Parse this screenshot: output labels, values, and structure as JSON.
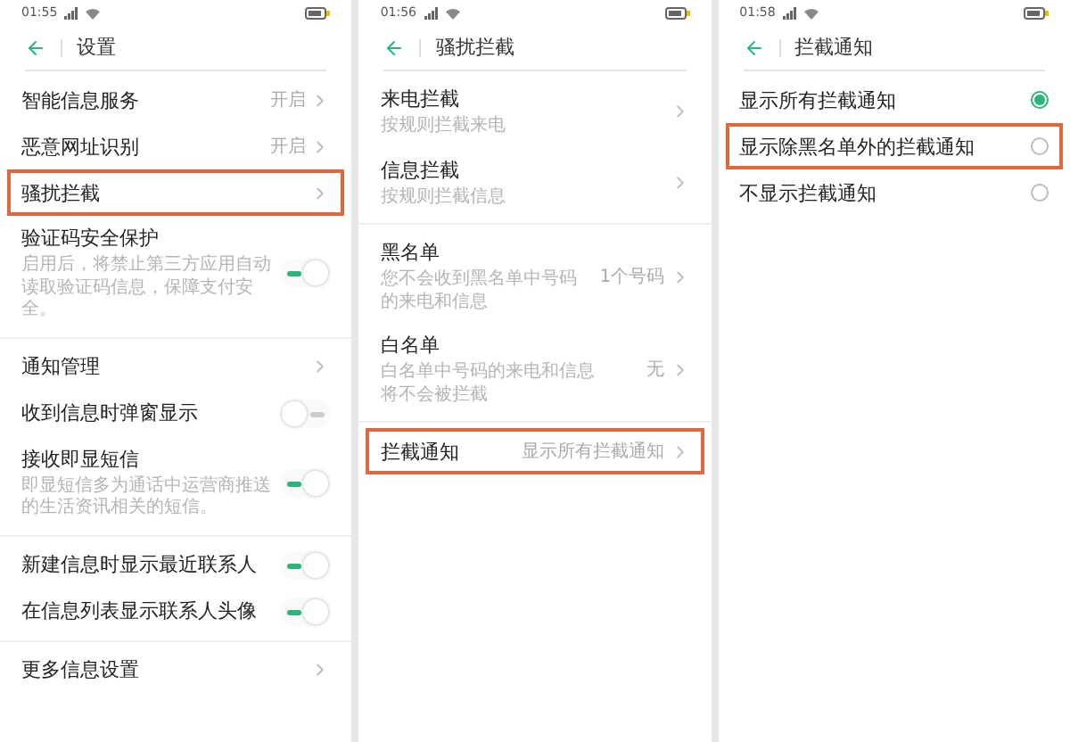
{
  "screens": [
    {
      "status_time": "01:55",
      "title": "设置",
      "sections": [
        [
          {
            "kind": "link",
            "title": "智能信息服务",
            "value": "开启",
            "highlighted": false
          },
          {
            "kind": "link",
            "title": "恶意网址识别",
            "value": "开启",
            "highlighted": false
          },
          {
            "kind": "link",
            "title": "骚扰拦截",
            "highlighted": true
          },
          {
            "kind": "switch",
            "title": "验证码安全保护",
            "description": "启用后，将禁止第三方应用自动读取验证码信息，保障支付安全。",
            "on": true,
            "highlighted": false
          }
        ],
        [
          {
            "kind": "link",
            "title": "通知管理",
            "highlighted": false
          },
          {
            "kind": "switch",
            "title": "收到信息时弹窗显示",
            "on": false,
            "highlighted": false
          },
          {
            "kind": "switch",
            "title": "接收即显短信",
            "description": "即显短信多为通话中运营商推送的生活资讯相关的短信。",
            "on": true,
            "highlighted": false
          }
        ],
        [
          {
            "kind": "switch",
            "title": "新建信息时显示最近联系人",
            "on": true,
            "highlighted": false
          },
          {
            "kind": "switch",
            "title": "在信息列表显示联系人头像",
            "on": true,
            "highlighted": false
          }
        ],
        [
          {
            "kind": "link",
            "title": "更多信息设置",
            "highlighted": false
          }
        ]
      ]
    },
    {
      "status_time": "01:56",
      "title": "骚扰拦截",
      "sections": [
        [
          {
            "kind": "link",
            "title": "来电拦截",
            "description": "按规则拦截来电",
            "highlighted": false
          },
          {
            "kind": "link",
            "title": "信息拦截",
            "description": "按规则拦截信息",
            "highlighted": false
          }
        ],
        [
          {
            "kind": "link",
            "title": "黑名单",
            "description": "您不会收到黑名单中号码的来电和信息",
            "value": "1个号码",
            "highlighted": false
          },
          {
            "kind": "link",
            "title": "白名单",
            "description": "白名单中号码的来电和信息将不会被拦截",
            "value": "无",
            "highlighted": false
          }
        ],
        [
          {
            "kind": "link",
            "title": "拦截通知",
            "value": "显示所有拦截通知",
            "highlighted": true
          }
        ]
      ]
    },
    {
      "status_time": "01:58",
      "title": "拦截通知",
      "sections": [
        [
          {
            "kind": "radio",
            "title": "显示所有拦截通知",
            "selected": true,
            "highlighted": false
          },
          {
            "kind": "radio",
            "title": "显示除黑名单外的拦截通知",
            "selected": false,
            "highlighted": true
          },
          {
            "kind": "radio",
            "title": "不显示拦截通知",
            "selected": false,
            "highlighted": false
          }
        ]
      ]
    }
  ]
}
